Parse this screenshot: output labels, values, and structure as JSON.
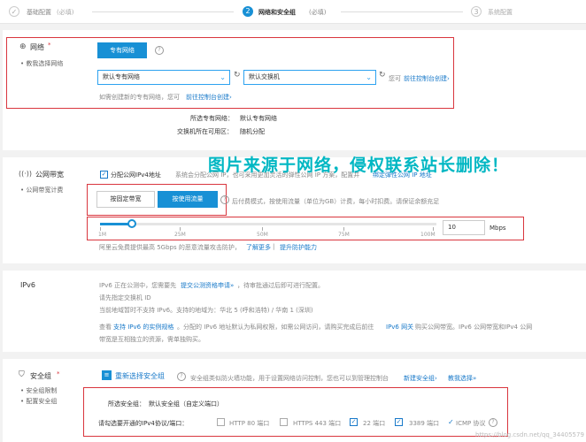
{
  "steps": [
    {
      "num": "✓",
      "label": "基础配置",
      "sub": "(必填)",
      "state": "done"
    },
    {
      "num": "2",
      "label": "网络和安全组",
      "sub": "(必填)",
      "state": "active"
    },
    {
      "num": "3",
      "label": "系统配置",
      "sub": "",
      "state": "todo"
    }
  ],
  "network": {
    "title": "网络",
    "required": "*",
    "sub": "教我选择网络",
    "tab_label": "专有网络",
    "vpc_select": "默认专有网络",
    "vswitch_select": "默认交换机",
    "console_prefix": "您可",
    "console_link": "前往控制台创建›",
    "hint_prefix": "如需创建新的专有网络，您可",
    "hint_link": "前往控制台创建›",
    "info_label_vpc": "所选专有网络：",
    "info_value_vpc": "默认专有网络",
    "info_label_zone": "交换机所在可用区：",
    "info_value_zone": "随机分配"
  },
  "bandwidth": {
    "title": "公网带宽",
    "sub": "公网带宽计费",
    "checkbox_label": "分配公网IPv4地址",
    "desc": "系统会分配公网 IP，也可采用更加灵活的弹性公网 IP 方案，配置并",
    "desc_link": "绑定弹性公网 IP 地址",
    "btn_fixed": "按固定带宽",
    "btn_traffic": "按使用流量",
    "traffic_desc": "后付费模式，按使用流量（单位为GB）计费，每小时扣费。请保证余额充足",
    "ticks": [
      "1M",
      "25M",
      "50M",
      "75M",
      "100M"
    ],
    "slider_value": "10",
    "unit": "Mbps",
    "ddos_prefix": "阿里云免费提供最高 5Gbps 的恶意流量攻击防护，",
    "ddos_link1": "了解更多",
    "ddos_sep": " | ",
    "ddos_link2": "提升防护能力"
  },
  "watermark": "图片来源于网络，侵权联系站长删除！",
  "ipv6": {
    "title": "IPv6",
    "line1_prefix": "IPv6 正在公测中，您需要先",
    "line1_link": "提交公测资格申请»",
    "line1_suffix": "，待审批通过后即可进行配置。",
    "line2": "请先指定交换机 ID",
    "line3": "当前地域暂时不支持 IPv6。支持的地域为：华北 5 (呼和浩特) / 华南 1 (深圳)",
    "line4_prefix": "查看",
    "line4_link1": "支持 IPv6 的实例规格",
    "line4_mid": "。分配的 IPv6 地址默认为私网权限，如需公网访问，请购买完成后前往",
    "line4_link2": "IPv6 网关",
    "line4_suffix": "购买公网带宽。IPv6 公网带宽和IPv4 公网",
    "line5": "带宽是互相独立的资源，需单独购买。"
  },
  "security": {
    "title": "安全组",
    "required": "*",
    "sub1": "安全组限制",
    "sub2": "配置安全组",
    "reselect": "重新选择安全组",
    "desc": "安全组类似防火墙功能，用于设置网络访问控制，您也可以到管理控制台",
    "link_new": "新建安全组›",
    "link_teach": "教我选择»",
    "selected_label": "所选安全组：",
    "selected_value": "默认安全组（自定义端口）",
    "ports_label": "请勾选要开通的IPv4协议/端口：",
    "ports": [
      {
        "label": "HTTP 80 端口",
        "checked": false
      },
      {
        "label": "HTTPS 443 端口",
        "checked": false
      },
      {
        "label": "22 端口",
        "checked": true
      },
      {
        "label": "3389 端口",
        "checked": true
      },
      {
        "label": "ICMP 协议",
        "checked": true
      }
    ],
    "watermark_url": "https://blog.csdn.net/qq_34405579"
  },
  "colors": {
    "accent": "#1890d5",
    "red": "#d9363e",
    "watermark": "#00b7c3"
  }
}
